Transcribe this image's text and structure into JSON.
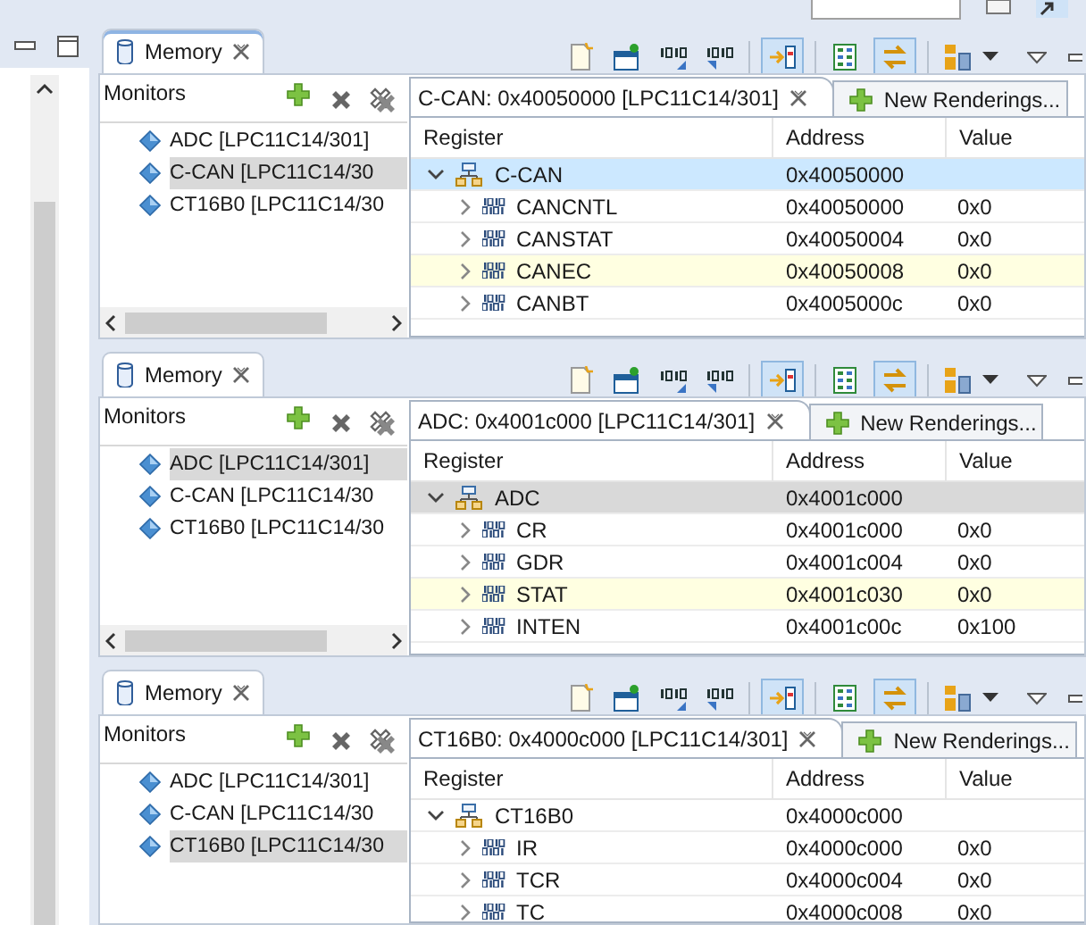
{
  "panels": [
    {
      "title": "Memory",
      "active": true,
      "monitors_label": "Monitors",
      "monitors": [
        {
          "label": "ADC [LPC11C14/301]",
          "selected": false
        },
        {
          "label": "C-CAN [LPC11C14/30",
          "selected": true
        },
        {
          "label": "CT16B0 [LPC11C14/30",
          "selected": false
        }
      ],
      "horizontal_scrollbar": true,
      "toolbar": [
        {
          "pressed": false
        },
        {
          "pressed": false
        },
        {
          "pressed": false
        },
        {
          "pressed": false
        },
        {
          "pressed": true
        },
        {
          "pressed": false
        },
        {
          "pressed": true
        },
        {
          "pressed": false
        }
      ],
      "rendering_tab": "C-CAN: 0x40050000 [LPC11C14/301]",
      "new_tab": "New Renderings...",
      "columns": [
        "Register",
        "Address",
        "Value"
      ],
      "group": {
        "name": "C-CAN",
        "address": "0x40050000",
        "selected": true,
        "expanded": true
      },
      "rows": [
        {
          "name": "CANCNTL",
          "address": "0x40050000",
          "value": "0x0",
          "highlighted": false
        },
        {
          "name": "CANSTAT",
          "address": "0x40050004",
          "value": "0x0",
          "highlighted": false
        },
        {
          "name": "CANEC",
          "address": "0x40050008",
          "value": "0x0",
          "highlighted": true
        },
        {
          "name": "CANBT",
          "address": "0x4005000c",
          "value": "0x0",
          "highlighted": false
        }
      ]
    },
    {
      "title": "Memory",
      "active": false,
      "monitors_label": "Monitors",
      "monitors": [
        {
          "label": "ADC [LPC11C14/301]",
          "selected": true
        },
        {
          "label": "C-CAN [LPC11C14/30",
          "selected": false
        },
        {
          "label": "CT16B0 [LPC11C14/30",
          "selected": false
        }
      ],
      "horizontal_scrollbar": true,
      "toolbar": [
        {
          "pressed": false
        },
        {
          "pressed": false
        },
        {
          "pressed": false
        },
        {
          "pressed": false
        },
        {
          "pressed": true
        },
        {
          "pressed": false
        },
        {
          "pressed": true
        },
        {
          "pressed": false
        }
      ],
      "rendering_tab": "ADC: 0x4001c000 [LPC11C14/301]",
      "new_tab": "New Renderings...",
      "columns": [
        "Register",
        "Address",
        "Value"
      ],
      "group": {
        "name": "ADC",
        "address": "0x4001c000",
        "selected": true,
        "expanded": true
      },
      "rows": [
        {
          "name": "CR",
          "address": "0x4001c000",
          "value": "0x0",
          "highlighted": false
        },
        {
          "name": "GDR",
          "address": "0x4001c004",
          "value": "0x0",
          "highlighted": false
        },
        {
          "name": "STAT",
          "address": "0x4001c030",
          "value": "0x0",
          "highlighted": true
        },
        {
          "name": "INTEN",
          "address": "0x4001c00c",
          "value": "0x100",
          "highlighted": false
        }
      ]
    },
    {
      "title": "Memory",
      "active": false,
      "monitors_label": "Monitors",
      "monitors": [
        {
          "label": "ADC [LPC11C14/301]",
          "selected": false
        },
        {
          "label": "C-CAN [LPC11C14/30",
          "selected": false
        },
        {
          "label": "CT16B0 [LPC11C14/30",
          "selected": true
        }
      ],
      "toolbar": [
        {
          "pressed": false
        },
        {
          "pressed": false
        },
        {
          "pressed": false
        },
        {
          "pressed": false
        },
        {
          "pressed": true
        },
        {
          "pressed": false
        },
        {
          "pressed": true
        },
        {
          "pressed": false
        }
      ],
      "rendering_tab": "CT16B0: 0x4000c000 [LPC11C14/301]",
      "new_tab": "New Renderings...",
      "columns": [
        "Register",
        "Address",
        "Value"
      ],
      "group": {
        "name": "CT16B0",
        "address": "0x4000c000",
        "selected": false,
        "expanded": true
      },
      "rows": [
        {
          "name": "IR",
          "address": "0x4000c000",
          "value": "0x0",
          "highlighted": false
        },
        {
          "name": "TCR",
          "address": "0x4000c004",
          "value": "0x0",
          "highlighted": false
        },
        {
          "name": "TC",
          "address": "0x4000c008",
          "value": "0x0",
          "highlighted": false
        }
      ]
    }
  ]
}
